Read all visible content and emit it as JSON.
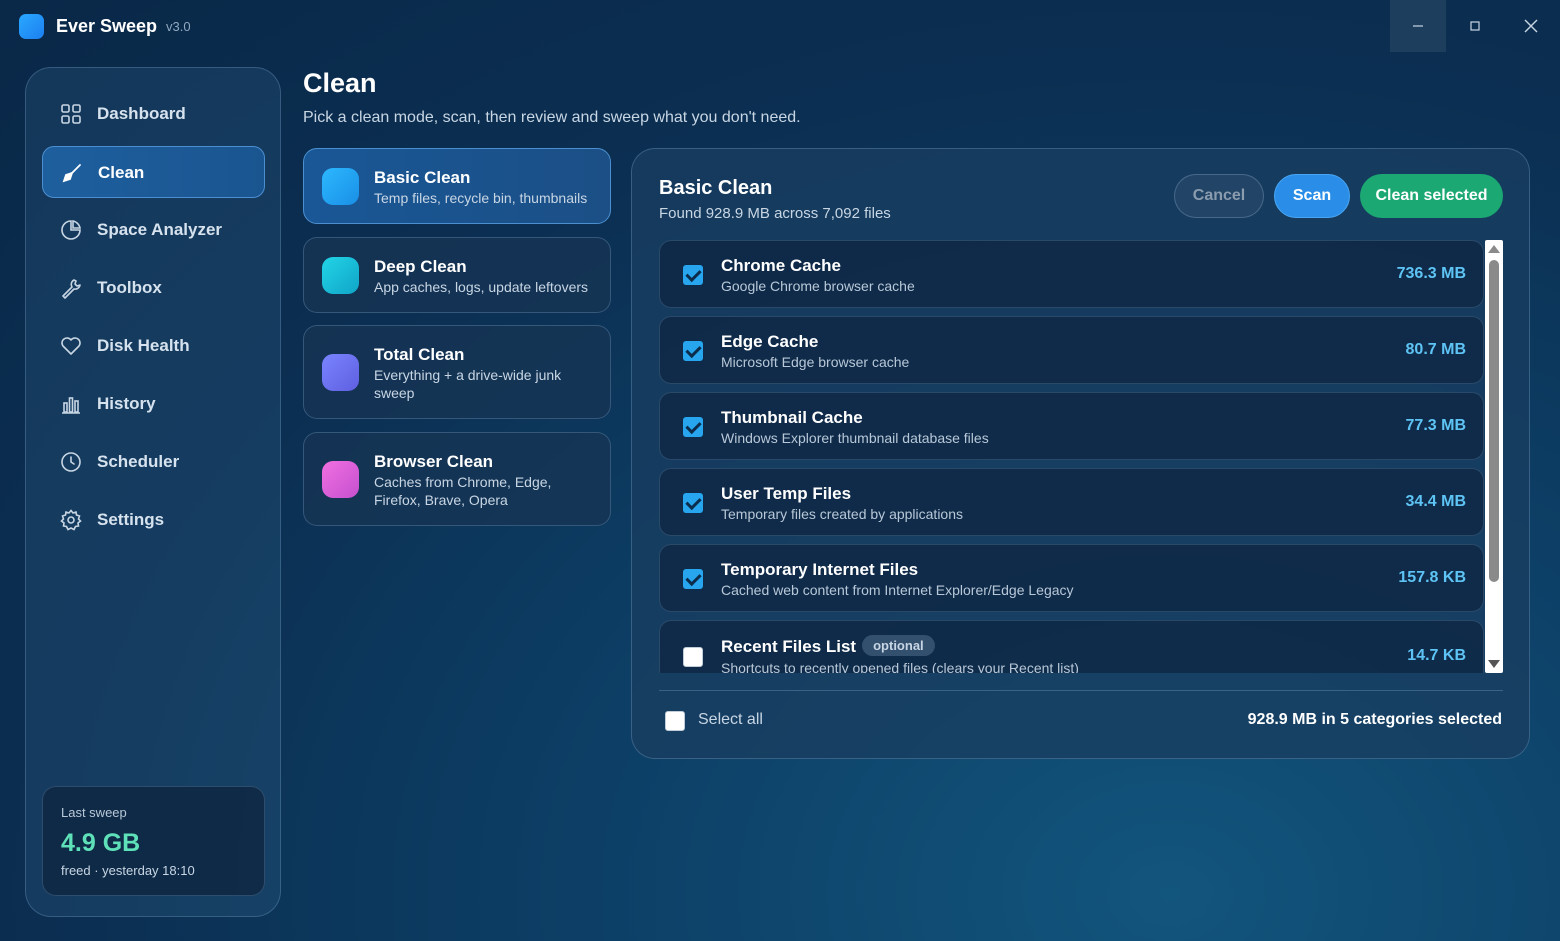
{
  "app": {
    "name": "Ever Sweep",
    "version": "v3.0"
  },
  "window_controls": {
    "minimize": "–",
    "maximize": "□",
    "close": "✕"
  },
  "sidebar": {
    "items": [
      {
        "label": "Dashboard",
        "icon": "grid-icon",
        "active": false
      },
      {
        "label": "Clean",
        "icon": "broom-icon",
        "active": true
      },
      {
        "label": "Space Analyzer",
        "icon": "pie-chart-icon",
        "active": false
      },
      {
        "label": "Toolbox",
        "icon": "wrench-icon",
        "active": false
      },
      {
        "label": "Disk Health",
        "icon": "heart-icon",
        "active": false
      },
      {
        "label": "History",
        "icon": "bar-chart-icon",
        "active": false
      },
      {
        "label": "Scheduler",
        "icon": "clock-icon",
        "active": false
      },
      {
        "label": "Settings",
        "icon": "gear-icon",
        "active": false
      }
    ],
    "last_sweep": {
      "title": "Last sweep",
      "value": "4.9 GB",
      "subtitle": "freed · yesterday 18:10"
    }
  },
  "header": {
    "title": "Clean",
    "subtitle": "Pick a clean mode, scan, then review and sweep what you don't need."
  },
  "modes": [
    {
      "title": "Basic Clean",
      "description": "Temp files, recycle bin, thumbnails",
      "color": "#1ea6ef",
      "active": true
    },
    {
      "title": "Deep Clean",
      "description": "App caches, logs, update leftovers",
      "color": "#17bcd8",
      "active": false
    },
    {
      "title": "Total Clean",
      "description": "Everything + a drive-wide junk sweep",
      "color": "#6e78f0",
      "active": false
    },
    {
      "title": "Browser Clean",
      "description": "Caches from Chrome, Edge, Firefox, Brave, Opera",
      "color": "#e060d8",
      "active": false
    }
  ],
  "panel": {
    "title": "Basic Clean",
    "summary": "Found 928.9 MB across 7,092 files",
    "buttons": {
      "cancel": "Cancel",
      "scan": "Scan",
      "clean": "Clean selected"
    },
    "items": [
      {
        "title": "Chrome Cache",
        "description": "Google Chrome browser cache",
        "size": "736.3 MB",
        "checked": true,
        "badge": ""
      },
      {
        "title": "Edge Cache",
        "description": "Microsoft Edge browser cache",
        "size": "80.7 MB",
        "checked": true,
        "badge": ""
      },
      {
        "title": "Thumbnail Cache",
        "description": "Windows Explorer thumbnail database files",
        "size": "77.3 MB",
        "checked": true,
        "badge": ""
      },
      {
        "title": "User Temp Files",
        "description": "Temporary files created by applications",
        "size": "34.4 MB",
        "checked": true,
        "badge": ""
      },
      {
        "title": "Temporary Internet Files",
        "description": "Cached web content from Internet Explorer/Edge Legacy",
        "size": "157.8 KB",
        "checked": true,
        "badge": ""
      },
      {
        "title": "Recent Files List",
        "description": "Shortcuts to recently opened files (clears your Recent list)",
        "size": "14.7 KB",
        "checked": false,
        "badge": "optional"
      }
    ],
    "select_all_label": "Select all",
    "selection_summary": "928.9 MB in 5 categories selected"
  },
  "colors": {
    "accent": "#2a8ee8",
    "success": "#1ba872",
    "size_text": "#5ec4f5",
    "freed": "#5ee0b8"
  }
}
